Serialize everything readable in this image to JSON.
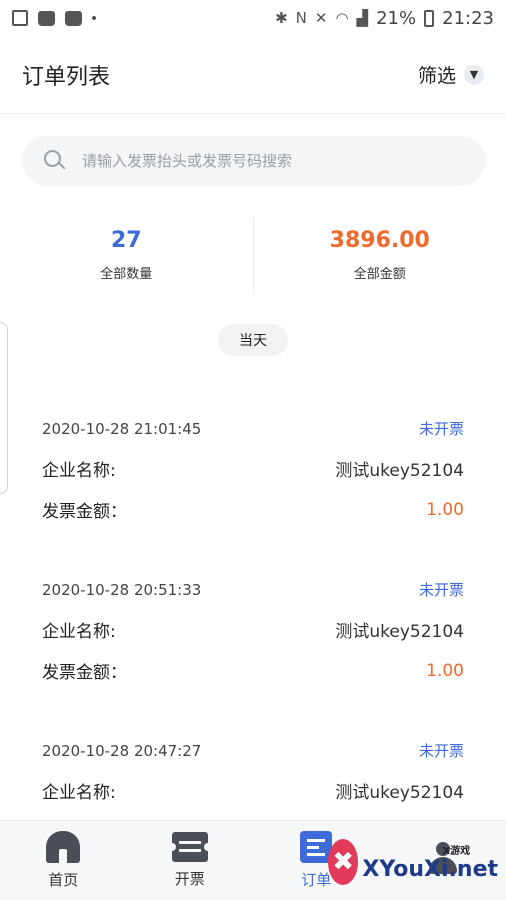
{
  "status_bar": {
    "battery": "21%",
    "time": "21:23",
    "icons": [
      "gallery-icon",
      "bag-icon",
      "bag-icon",
      "dot-icon",
      "bluetooth-icon",
      "nfc-icon",
      "mute-icon",
      "wifi-icon",
      "signal-icon",
      "battery-icon"
    ]
  },
  "header": {
    "title": "订单列表",
    "filter_label": "筛选"
  },
  "search": {
    "placeholder": "请输入发票抬头或发票号码搜索"
  },
  "stats": {
    "count_value": "27",
    "count_label": "全部数量",
    "amount_value": "3896.00",
    "amount_label": "全部金额",
    "colors": {
      "count": "#3d6bd9",
      "amount": "#ee6a2f"
    }
  },
  "date_chip": "当天",
  "orders": [
    {
      "time": "2020-10-28 21:01:45",
      "status": "未开票",
      "company_label": "企业名称:",
      "company": "测试ukey52104",
      "amount_label": "发票金额：",
      "amount": "1.00"
    },
    {
      "time": "2020-10-28 20:51:33",
      "status": "未开票",
      "company_label": "企业名称:",
      "company": "测试ukey52104",
      "amount_label": "发票金额：",
      "amount": "1.00"
    },
    {
      "time": "2020-10-28 20:47:27",
      "status": "未开票",
      "company_label": "企业名称:",
      "company": "测试ukey52104",
      "amount_label": "",
      "amount": ""
    }
  ],
  "tabbar": {
    "items": [
      {
        "label": "首页",
        "icon": "home-icon",
        "active": false
      },
      {
        "label": "开票",
        "icon": "ticket-icon",
        "active": false
      },
      {
        "label": "订单",
        "icon": "order-icon",
        "active": true
      },
      {
        "label": "",
        "icon": "user-icon",
        "active": false
      }
    ],
    "accent": "#3d6bd9"
  },
  "watermark": {
    "small": "X游戏",
    "big": "XYouXi.net"
  }
}
